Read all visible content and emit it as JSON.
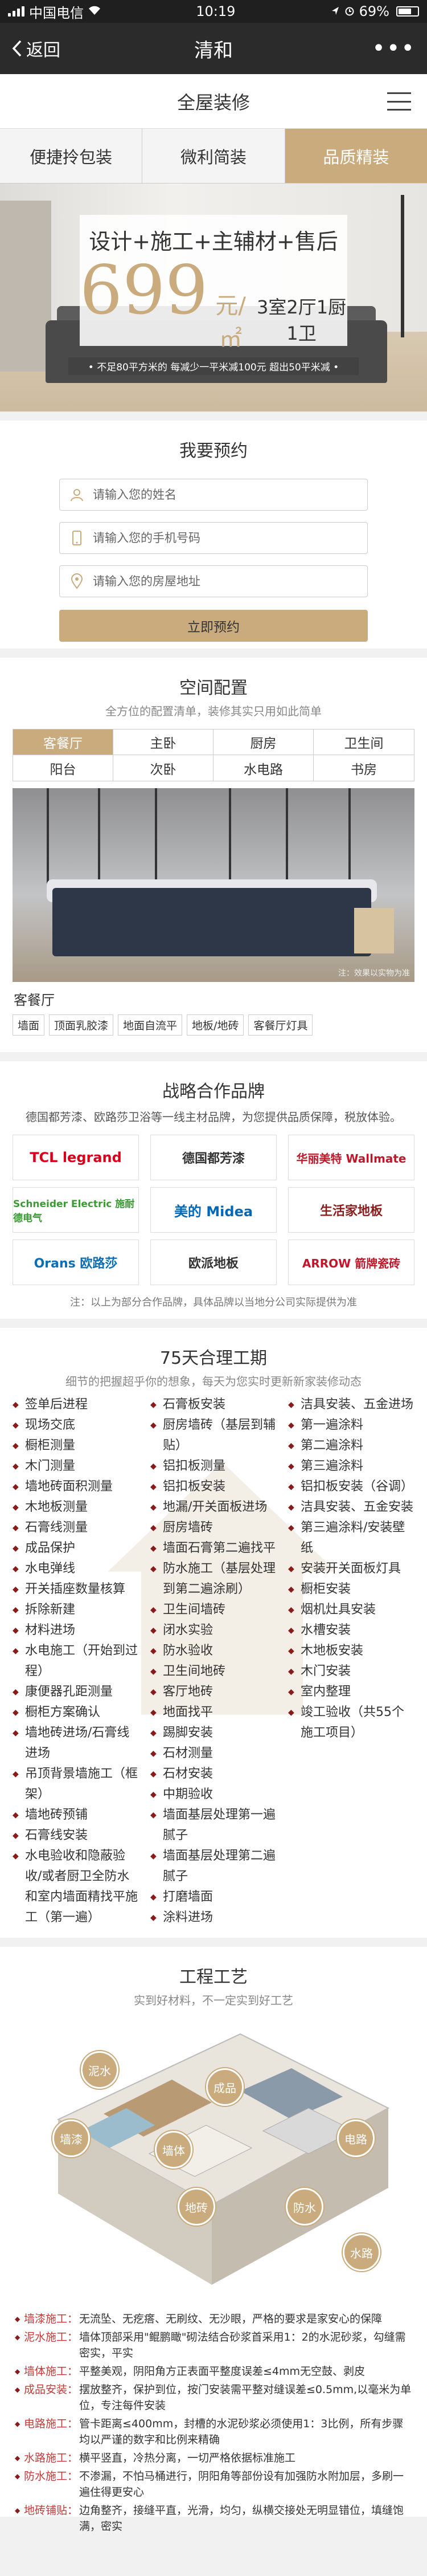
{
  "status": {
    "carrier": "中国电信",
    "time": "10:19",
    "battery": "69%"
  },
  "nav": {
    "back": "返回",
    "title": "清和",
    "more": "•••"
  },
  "header": {
    "title": "全屋装修"
  },
  "tabs": [
    "便捷拎包装",
    "微利简装",
    "品质精装"
  ],
  "hero": {
    "line1": "设计+施工+主辅材+售后",
    "price": "699",
    "unit": "元/㎡",
    "rooms": "3室2厅1厨1卫",
    "note": "• 不足80平方米的  每减少一平米减100元  超出50平米减 •"
  },
  "booking": {
    "title": "我要预约",
    "name_placeholder": "请输入您的姓名",
    "phone_placeholder": "请输入您的手机号码",
    "address_placeholder": "请输入您的房屋地址",
    "submit": "立即预约"
  },
  "space": {
    "title": "空间配置",
    "subtitle": "全方位的配置清单，装修其实只用如此简单",
    "items": [
      "客餐厅",
      "主卧",
      "厨房",
      "卫生间",
      "阳台",
      "次卧",
      "水电路",
      "书房"
    ],
    "watermark": "注：效果以实物为准",
    "room_name": "客餐厅",
    "tags": [
      "墙面",
      "顶面乳胶漆",
      "地面自流平",
      "地板/地砖",
      "客餐厅灯具"
    ]
  },
  "partners": {
    "title": "战略合作品牌",
    "subtitle": "德国都芳漆、欧路莎卫浴等一线主材品牌，为您提供品质保障，税放体验。",
    "brands": [
      "TCL legrand",
      "德国都芳漆",
      "华丽美特 Wallmate",
      "Schneider Electric 施耐德电气",
      "美的 Midea",
      "生活家地板",
      "Orans 欧路莎",
      "欧派地板",
      "ARROW 箭牌瓷砖"
    ],
    "note": "注：以上为部分合作品牌，具体品牌以当地分公司实际提供为准"
  },
  "schedule": {
    "title": "75天合理工期",
    "subtitle": "细节的把握超乎你的想象，每天为您实时更新新家装修动态",
    "col1": [
      "签单后进程",
      "现场交底",
      "橱柜测量",
      "木门测量",
      "墙地砖面积测量",
      "木地板测量",
      "石膏线测量",
      "成品保护",
      "水电弹线",
      "开关插座数量核算",
      "拆除新建",
      "材料进场",
      "水电施工（开始到过程）",
      "康便器孔距测量",
      "橱柜方案确认",
      "墙地砖进场/石膏线进场",
      "吊顶背景墙施工（框架）",
      "墙地砖预铺",
      "石膏线安装",
      "水电验收和隐蔽验收/或者厨卫全防水和室内墙面精找平施工（第一遍）"
    ],
    "col2": [
      "石膏板安装",
      "厨房墙砖（基层到辅贴）",
      "铝扣板测量",
      "铝扣板安装",
      "地漏/开关面板进场",
      "厨房墙砖",
      "墙面石膏第二遍找平",
      "防水施工（基层处理到第二遍涂刷）",
      "卫生间墙砖",
      "闭水实验",
      "防水验收",
      "卫生间地砖",
      "客厅地砖",
      "地面找平",
      "踢脚安装",
      "石材测量",
      "石材安装",
      "中期验收",
      "墙面基层处理第一遍腻子",
      "墙面基层处理第二遍腻子",
      "打磨墙面",
      "涂料进场"
    ],
    "col3": [
      "洁具安装、五金进场",
      "第一遍涂料",
      "第二遍涂料",
      "第三遍涂料",
      "铝扣板安装（谷调）",
      "洁具安装、五金安装",
      "第三遍涂料/安装壁纸",
      "安装开关面板灯具",
      "橱柜安装",
      "烟机灶具安装",
      "水槽安装",
      "木地板安装",
      "木门安装",
      "室内整理",
      "竣工验收（共55个施工项目）"
    ]
  },
  "craft": {
    "title": "工程工艺",
    "subtitle": "实到好材料，不一定实到好工艺",
    "labels": [
      "泥水",
      "成品",
      "墙漆",
      "墙体",
      "电路",
      "地砖",
      "防水",
      "水路"
    ],
    "legend": [
      {
        "k": "墙漆施工：",
        "v": "无流坠、无疙瘩、无刷纹、无沙眼，严格的要求是家安心的保障"
      },
      {
        "k": "泥水施工：",
        "v": "墙体顶部采用\"鲲鹏瞰\"砌法结合砂浆首采用1：2的水泥砂浆，勾缝需密实，平实"
      },
      {
        "k": "墙体施工：",
        "v": "平整美观，阴阳角方正表面平整度误差≤4mm无空鼓、剥皮"
      },
      {
        "k": "成品安装：",
        "v": "摆放整齐，保护到位，按门安装需平整对缝误差≤0.5mm,以毫米为单位，专注每件安装"
      },
      {
        "k": "电路施工：",
        "v": "管卡距离≤400mm，封槽的水泥砂浆必须使用1：3比例，所有步骤均以严谨的数字和比例来精确"
      },
      {
        "k": "水路施工：",
        "v": "横平竖直，冷热分离，一切严格依据标准施工"
      },
      {
        "k": "防水施工：",
        "v": "不渗漏，不怕马桶进行，阴阳角等部份设有加强防水附加层，多刷一遍住得更安心"
      },
      {
        "k": "地砖铺贴：",
        "v": "边角整齐，接缝平直，光滑，均匀，纵横交接处无明显错位，填缝饱满，密实"
      }
    ]
  }
}
